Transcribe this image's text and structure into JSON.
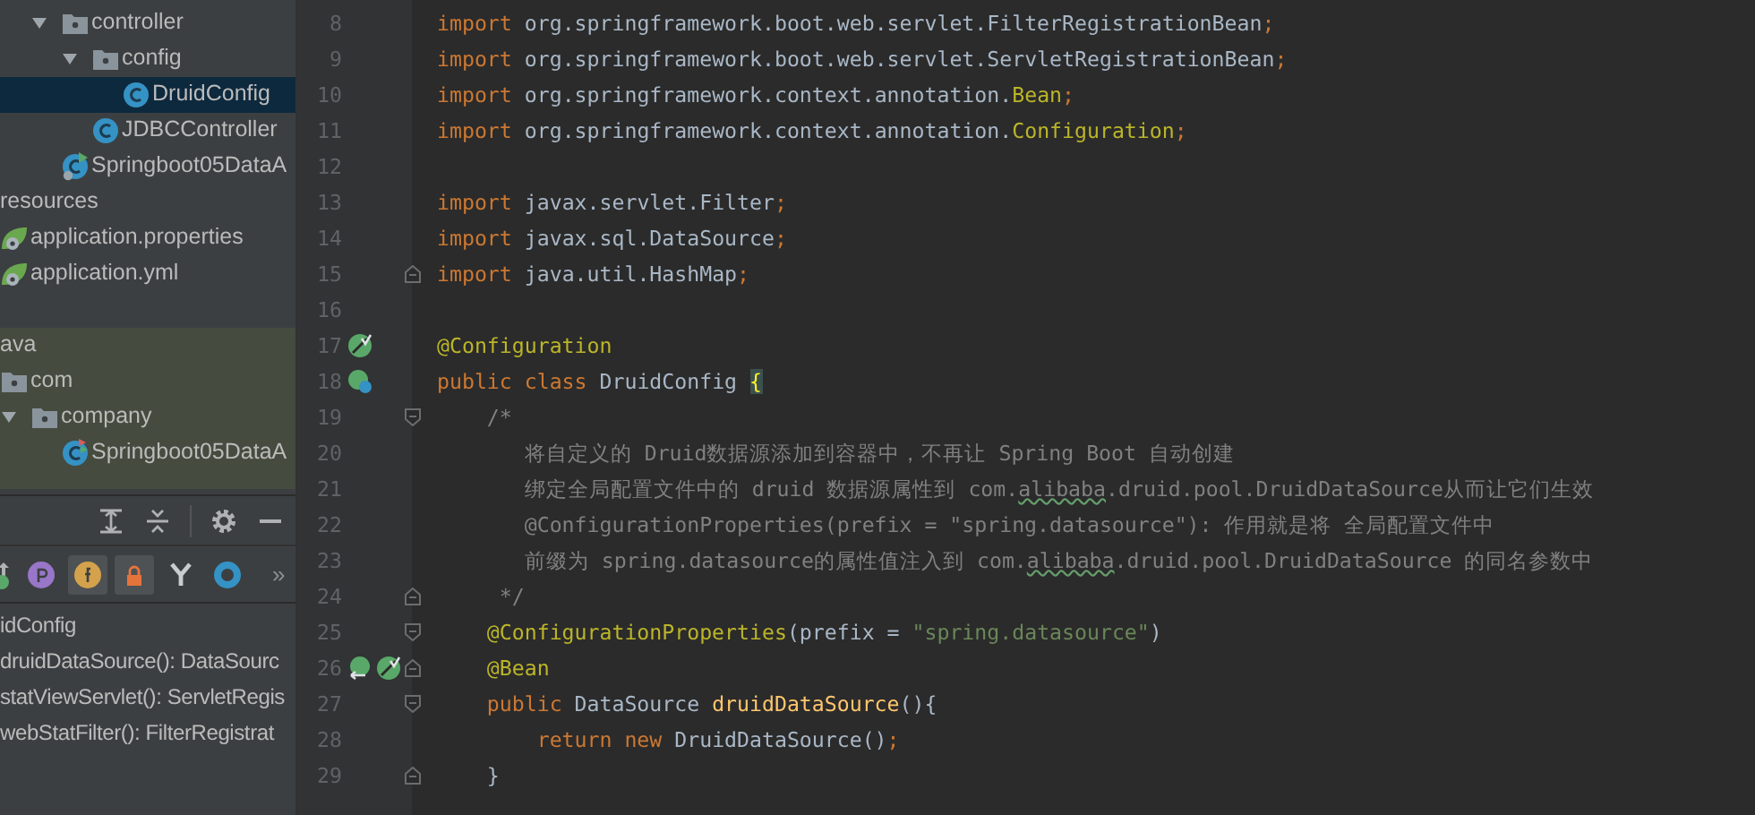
{
  "project_tree": {
    "groups": [
      {
        "kind": "source",
        "items": [
          {
            "label": "controller",
            "kind": "package",
            "expanded": true,
            "selected": false,
            "children": [
              {
                "label": "config",
                "kind": "package",
                "expanded": true,
                "selected": false,
                "children": [
                  {
                    "label": "DruidConfig",
                    "kind": "class",
                    "selected": true
                  }
                ]
              },
              {
                "label": "JDBCController",
                "kind": "class",
                "selected": false
              }
            ]
          },
          {
            "label": "Springboot05DataA",
            "kind": "boot-app",
            "selected": false
          }
        ]
      },
      {
        "kind": "resources",
        "items": [
          {
            "label": "resources",
            "expanded": true,
            "selected": false,
            "children": [
              {
                "label": "application.properties",
                "kind": "config-file",
                "selected": false
              },
              {
                "label": "application.yml",
                "kind": "config-file",
                "selected": false
              }
            ]
          }
        ]
      },
      {
        "kind": "test",
        "items": [
          {
            "label": "ava",
            "expanded": true,
            "selected": false,
            "children": [
              {
                "label": "com",
                "kind": "package",
                "expanded": true,
                "selected": false,
                "children": [
                  {
                    "label": "company",
                    "kind": "package",
                    "expanded": true,
                    "selected": false,
                    "children": [
                      {
                        "label": "Springboot05DataA",
                        "kind": "boot-test",
                        "selected": false
                      }
                    ]
                  }
                ]
              }
            ]
          }
        ]
      }
    ]
  },
  "structure": {
    "toggles": [
      {
        "kind": "sort",
        "selected": false
      },
      {
        "kind": "properties",
        "selected": false
      },
      {
        "kind": "fields",
        "selected": true
      },
      {
        "kind": "non-public",
        "selected": true
      },
      {
        "kind": "inherited",
        "selected": false
      },
      {
        "kind": "anonymous",
        "selected": false
      }
    ],
    "more": "»",
    "items": [
      {
        "label": "idConfig",
        "children": [
          {
            "label": "druidDataSource(): DataSourc"
          },
          {
            "label": "statViewServlet(): ServletRegis"
          },
          {
            "label": "webStatFilter(): FilterRegistrat"
          }
        ]
      }
    ]
  },
  "editor": {
    "lines": [
      {
        "number": "8",
        "segments": [
          {
            "kind": "keyword",
            "text": "import "
          },
          {
            "kind": "plain",
            "text": "org.springframework.boot.web.servlet.FilterRegistrationBean"
          },
          {
            "kind": "keyword",
            "text": ";"
          }
        ]
      },
      {
        "number": "9",
        "segments": [
          {
            "kind": "keyword",
            "text": "import "
          },
          {
            "kind": "plain",
            "text": "org.springframework.boot.web.servlet.ServletRegistrationBean"
          },
          {
            "kind": "keyword",
            "text": ";"
          }
        ]
      },
      {
        "number": "10",
        "segments": [
          {
            "kind": "keyword",
            "text": "import "
          },
          {
            "kind": "plain",
            "text": "org.springframework.context.annotation."
          },
          {
            "kind": "annotation",
            "text": "Bean"
          },
          {
            "kind": "keyword",
            "text": ";"
          }
        ]
      },
      {
        "number": "11",
        "segments": [
          {
            "kind": "keyword",
            "text": "import "
          },
          {
            "kind": "plain",
            "text": "org.springframework.context.annotation."
          },
          {
            "kind": "annotation",
            "text": "Configuration"
          },
          {
            "kind": "keyword",
            "text": ";"
          }
        ]
      },
      {
        "number": "12"
      },
      {
        "number": "13",
        "segments": [
          {
            "kind": "keyword",
            "text": "import "
          },
          {
            "kind": "plain",
            "text": "javax.servlet.Filter"
          },
          {
            "kind": "keyword",
            "text": ";"
          }
        ]
      },
      {
        "number": "14",
        "segments": [
          {
            "kind": "keyword",
            "text": "import "
          },
          {
            "kind": "plain",
            "text": "javax.sql.DataSource"
          },
          {
            "kind": "keyword",
            "text": ";"
          }
        ]
      },
      {
        "number": "15",
        "fold_end": true,
        "segments": [
          {
            "kind": "keyword",
            "text": "import "
          },
          {
            "kind": "plain",
            "text": "java.util.HashMap"
          },
          {
            "kind": "keyword",
            "text": ";"
          }
        ]
      },
      {
        "number": "16"
      },
      {
        "number": "17",
        "gutter_icons": [
          {
            "kind": "bean-config"
          }
        ],
        "segments": [
          {
            "kind": "annotation",
            "text": "@Configuration"
          }
        ]
      },
      {
        "number": "18",
        "gutter_icons": [
          {
            "kind": "bean-class"
          }
        ],
        "segments": [
          {
            "kind": "keyword",
            "text": "public class "
          },
          {
            "kind": "plain",
            "text": "DruidConfig "
          },
          {
            "kind": "brace",
            "text": "{"
          }
        ]
      },
      {
        "number": "19",
        "fold_start": true,
        "segments": [
          {
            "kind": "comment",
            "text": "    /*"
          }
        ]
      },
      {
        "number": "20",
        "segments": [
          {
            "kind": "comment",
            "text": "       将自定义的 Druid数据源添加到容器中，不再让 Spring Boot 自动创建"
          }
        ]
      },
      {
        "number": "21",
        "segments": [
          {
            "kind": "comment",
            "text": "       绑定全局配置文件中的 druid 数据源属性到 com."
          },
          {
            "kind": "typo",
            "text": "alibaba"
          },
          {
            "kind": "comment",
            "text": ".druid.pool.DruidDataSource从而让它们生效"
          }
        ]
      },
      {
        "number": "22",
        "segments": [
          {
            "kind": "comment",
            "text": "       @ConfigurationProperties(prefix = \"spring.datasource\"): 作用就是将 全局配置文件中"
          }
        ]
      },
      {
        "number": "23",
        "segments": [
          {
            "kind": "comment",
            "text": "       前缀为 spring.datasource的属性值注入到 com."
          },
          {
            "kind": "typo",
            "text": "alibaba"
          },
          {
            "kind": "comment",
            "text": ".druid.pool.DruidDataSource 的同名参数中"
          }
        ]
      },
      {
        "number": "24",
        "fold_end": true,
        "segments": [
          {
            "kind": "comment",
            "text": "     */"
          }
        ]
      },
      {
        "number": "25",
        "fold_start": true,
        "segments": [
          {
            "kind": "annotation",
            "text": "    @ConfigurationProperties"
          },
          {
            "kind": "plain",
            "text": "(prefix = "
          },
          {
            "kind": "string",
            "text": "\"spring.datasource\""
          },
          {
            "kind": "plain",
            "text": ")"
          }
        ]
      },
      {
        "number": "26",
        "fold_end": true,
        "gutter_icons": [
          {
            "kind": "bean-navigate"
          },
          {
            "kind": "bean-config"
          }
        ],
        "segments": [
          {
            "kind": "annotation",
            "text": "    @Bean"
          }
        ]
      },
      {
        "number": "27",
        "fold_start": true,
        "segments": [
          {
            "kind": "keyword",
            "text": "    public "
          },
          {
            "kind": "plain",
            "text": "DataSource "
          },
          {
            "kind": "method",
            "text": "druidDataSource"
          },
          {
            "kind": "plain",
            "text": "(){"
          }
        ]
      },
      {
        "number": "28",
        "segments": [
          {
            "kind": "keyword",
            "text": "        return new "
          },
          {
            "kind": "plain",
            "text": "DruidDataSource()"
          },
          {
            "kind": "keyword",
            "text": ";"
          }
        ]
      },
      {
        "number": "29",
        "fold_end": true,
        "segments": [
          {
            "kind": "plain",
            "text": "    }"
          }
        ]
      }
    ]
  }
}
